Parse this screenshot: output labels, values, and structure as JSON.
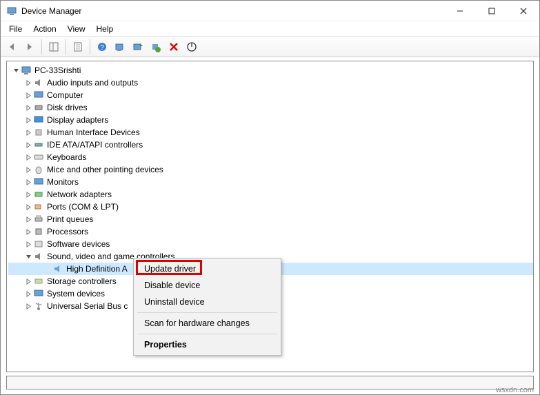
{
  "window": {
    "title": "Device Manager"
  },
  "menu": {
    "file": "File",
    "action": "Action",
    "view": "View",
    "help": "Help"
  },
  "tree": {
    "root": "PC-33Srishti",
    "items": [
      "Audio inputs and outputs",
      "Computer",
      "Disk drives",
      "Display adapters",
      "Human Interface Devices",
      "IDE ATA/ATAPI controllers",
      "Keyboards",
      "Mice and other pointing devices",
      "Monitors",
      "Network adapters",
      "Ports (COM & LPT)",
      "Print queues",
      "Processors",
      "Software devices",
      "Sound, video and game controllers",
      "Storage controllers",
      "System devices",
      "Universal Serial Bus c"
    ],
    "sound_child": "High Definition A"
  },
  "context_menu": {
    "update": "Update driver",
    "disable": "Disable device",
    "uninstall": "Uninstall device",
    "scan": "Scan for hardware changes",
    "properties": "Properties"
  },
  "watermark": "wsxdn.com"
}
